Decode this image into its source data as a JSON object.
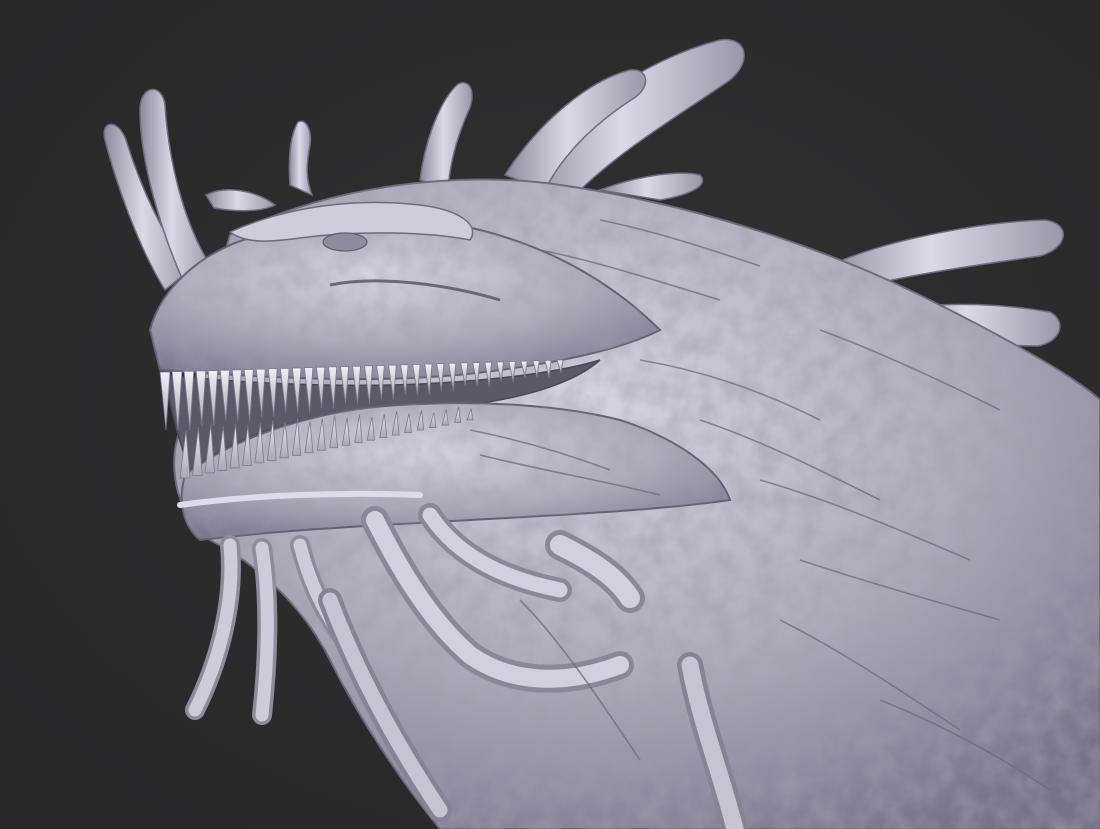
{
  "viewport": {
    "background_color": "#2b2b2c",
    "model_color": "#b9b6c6",
    "model_shadow_color": "#6e6b7a",
    "model_highlight_color": "#e6e4ef"
  },
  "model": {
    "subject": "dragon-head-sculpt"
  }
}
